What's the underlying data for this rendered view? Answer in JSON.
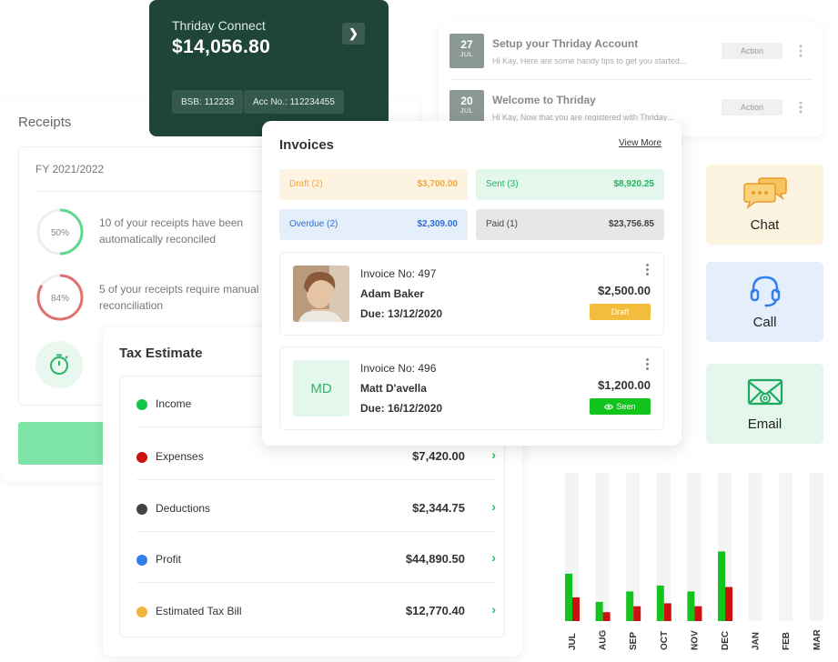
{
  "bank": {
    "name": "Thriday Connect",
    "balance": "$14,056.80",
    "bsb": "BSB: 112233",
    "account": "Acc No.: 112234455",
    "go_icon": "chevron-right-icon"
  },
  "notifications": [
    {
      "day": "27",
      "month": "JUL",
      "title": "Setup your Thriday Account",
      "subtitle": "Hi Kay, Here are some handy tips to get you started...",
      "action": "Action"
    },
    {
      "day": "20",
      "month": "JUL",
      "title": "Welcome to Thriday",
      "subtitle": "Hi Kay, Now that you are registered with Thriday...",
      "action": "Action"
    }
  ],
  "receipts": {
    "title": "Receipts",
    "fy": "FY 2021/2022",
    "items": [
      {
        "percent_label": "50%",
        "percent": 50,
        "color": "#5fd88e",
        "text": "10 of your receipts have been automatically reconciled"
      },
      {
        "percent_label": "84%",
        "percent": 84,
        "color": "#e07171",
        "text": "5 of your receipts require manual reconciliation"
      }
    ],
    "clock_icon": "timer-icon"
  },
  "tax": {
    "title": "Tax Estimate",
    "rows": [
      {
        "label": "Income",
        "value": "",
        "color": "#13c44a"
      },
      {
        "label": "Expenses",
        "value": "$7,420.00",
        "color": "#cc1111"
      },
      {
        "label": "Deductions",
        "value": "$2,344.75",
        "color": "#444444"
      },
      {
        "label": "Profit",
        "value": "$44,890.50",
        "color": "#2f80ed"
      },
      {
        "label": "Estimated Tax Bill",
        "value": "$12,770.40",
        "color": "#f2b53c"
      }
    ]
  },
  "invoices": {
    "title": "Invoices",
    "view_more": "View More",
    "stats": [
      {
        "label": "Draft (2)",
        "value": "$3,700.00"
      },
      {
        "label": "Sent (3)",
        "value": "$8,920.25"
      },
      {
        "label": "Overdue (2)",
        "value": "$2,309.00"
      },
      {
        "label": "Paid (1)",
        "value": "$23,756.85"
      }
    ],
    "items": [
      {
        "number": "Invoice No: 497",
        "name": "Adam Baker",
        "due": "Due: 13/12/2020",
        "amount": "$2,500.00",
        "status": "Draft"
      },
      {
        "number": "Invoice No: 496",
        "name": "Matt D'avella",
        "initials": "MD",
        "due": "Due: 16/12/2020",
        "amount": "$1,200.00",
        "status": "Seen"
      }
    ]
  },
  "contact": [
    {
      "label": "Chat",
      "icon": "chat-bubble-icon",
      "bg": "#fdf3e1"
    },
    {
      "label": "Call",
      "icon": "headset-icon",
      "bg": "#e5eefb"
    },
    {
      "label": "Email",
      "icon": "email-icon",
      "bg": "#e3f7ec"
    }
  ],
  "chart_data": {
    "type": "bar",
    "categories": [
      "JUL",
      "AUG",
      "SEP",
      "OCT",
      "NOV",
      "DEC",
      "JAN",
      "FEB",
      "MAR"
    ],
    "series": [
      {
        "values": [
          32,
          13,
          20,
          24,
          20,
          47,
          0,
          0,
          0
        ],
        "color": "#13c41c"
      },
      {
        "values": [
          16,
          6,
          10,
          12,
          10,
          23,
          0,
          0,
          0
        ],
        "color": "#cc1111"
      }
    ],
    "ylim": [
      0,
      100
    ],
    "background_bar_color": "#f4f4f4",
    "grid": false
  }
}
